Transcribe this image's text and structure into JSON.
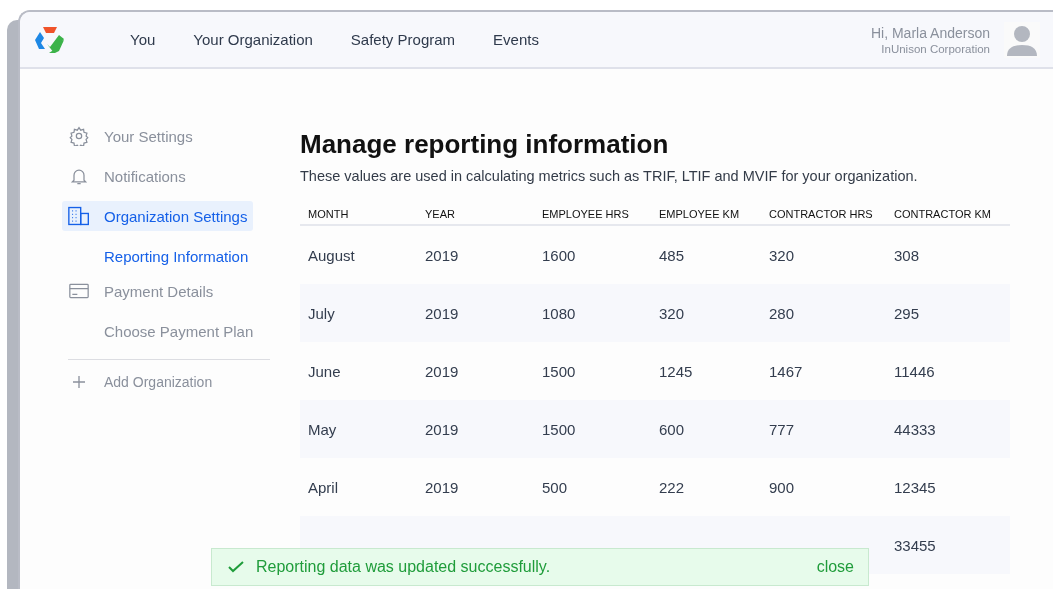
{
  "nav": {
    "items": [
      {
        "label": "You",
        "selected": false
      },
      {
        "label": "Your Organization",
        "selected": false
      },
      {
        "label": "Safety Program",
        "selected": false
      },
      {
        "label": "Events",
        "selected": false
      }
    ],
    "user": {
      "greeting": "Hi, Marla Anderson",
      "company": "InUnison Corporation"
    }
  },
  "sidebar": {
    "items": [
      {
        "label": "Your Settings",
        "kind": "main",
        "selected": false
      },
      {
        "label": "Notifications",
        "kind": "main",
        "selected": false
      },
      {
        "label": "Organization Settings",
        "kind": "main",
        "selected": true
      },
      {
        "label": "Reporting Information",
        "kind": "sub",
        "selected": true
      },
      {
        "label": "Payment Details",
        "kind": "main",
        "selected": false
      },
      {
        "label": "Choose Payment Plan",
        "kind": "sub",
        "selected": false
      }
    ],
    "add_label": "Add Organization"
  },
  "main": {
    "title": "Manage reporting information",
    "subtitle": "These values are used in calculating metrics such as TRIF, LTIF and MVIF for your organization.",
    "table": {
      "columns": [
        "MONTH",
        "YEAR",
        "EMPLOYEE HRS",
        "EMPLOYEE KM",
        "CONTRACTOR HRS",
        "CONTRACTOR KM"
      ],
      "rows": [
        {
          "cells": [
            "August",
            "2019",
            "1600",
            "485",
            "320",
            "308"
          ]
        },
        {
          "cells": [
            "July",
            "2019",
            "1080",
            "320",
            "280",
            "295"
          ]
        },
        {
          "cells": [
            "June",
            "2019",
            "1500",
            "1245",
            "1467",
            "11446"
          ]
        },
        {
          "cells": [
            "May",
            "2019",
            "1500",
            "600",
            "777",
            "44333"
          ]
        },
        {
          "cells": [
            "April",
            "2019",
            "500",
            "222",
            "900",
            "12345"
          ]
        },
        {
          "cells": [
            null,
            null,
            null,
            null,
            null,
            "33455"
          ]
        }
      ]
    }
  },
  "toast": {
    "message": "Reporting data was updated successfully.",
    "action": "close"
  }
}
